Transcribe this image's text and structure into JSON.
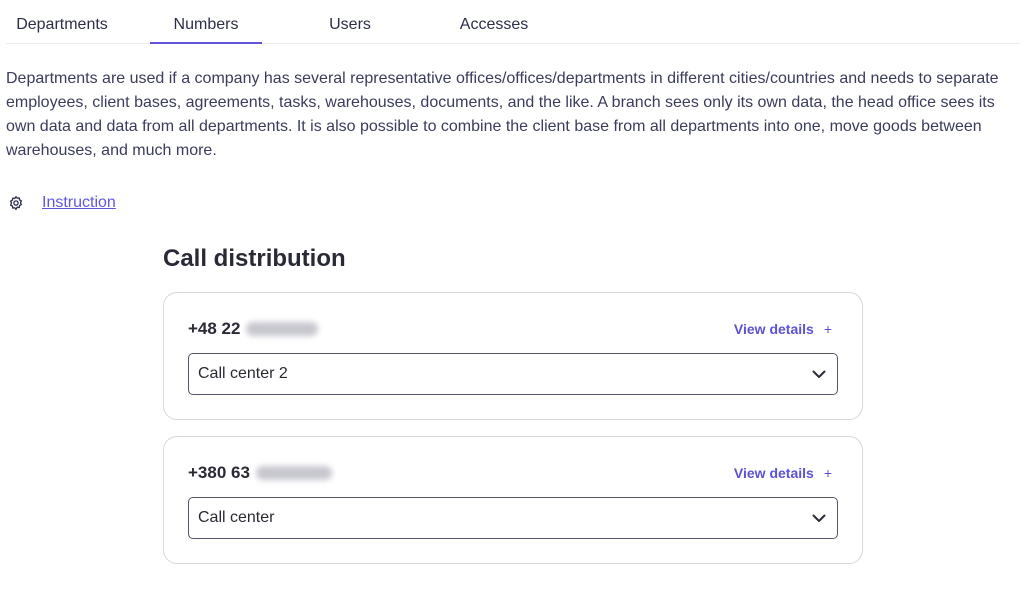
{
  "tabs": [
    {
      "label": "Departments"
    },
    {
      "label": "Numbers"
    },
    {
      "label": "Users"
    },
    {
      "label": "Accesses"
    }
  ],
  "active_tab": "Numbers",
  "description": "Departments are used if a company has several representative offices/offices/departments in different cities/countries and needs to separate employees, client bases, agreements, tasks, warehouses, documents, and the like. A branch sees only its own data, the head office sees its own data and data from all departments. It is also possible to combine the client base from all departments into one, move goods between warehouses, and much more.",
  "instruction": {
    "icon": "gear-icon",
    "label": "Instruction"
  },
  "section_title": "Call distribution",
  "numbers": [
    {
      "phone_prefix": "+48 22",
      "details_label": "View details",
      "details_icon": "plus-icon",
      "selected": "Call center 2"
    },
    {
      "phone_prefix": "+380 63",
      "details_label": "View details",
      "details_icon": "plus-icon",
      "selected": "Call center"
    }
  ],
  "colors": {
    "accent": "#6155e0",
    "text": "#2d2f4a",
    "border": "#d6d6de"
  }
}
